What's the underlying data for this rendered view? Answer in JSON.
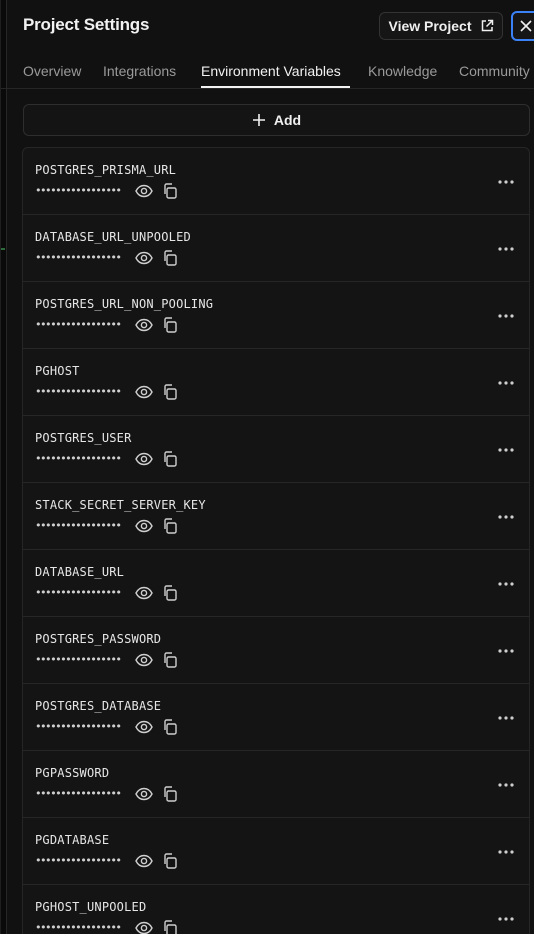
{
  "header": {
    "title": "Project Settings",
    "view_project_label": "View Project"
  },
  "tabs": [
    {
      "label": "Overview",
      "active": false
    },
    {
      "label": "Integrations",
      "active": false
    },
    {
      "label": "Environment Variables",
      "active": true
    },
    {
      "label": "Knowledge",
      "active": false
    },
    {
      "label": "Community",
      "active": false
    }
  ],
  "add_button_label": "Add",
  "masked_value": "•••••••••••••••••",
  "env_vars": [
    {
      "name": "POSTGRES_PRISMA_URL"
    },
    {
      "name": "DATABASE_URL_UNPOOLED"
    },
    {
      "name": "POSTGRES_URL_NON_POOLING"
    },
    {
      "name": "PGHOST"
    },
    {
      "name": "POSTGRES_USER"
    },
    {
      "name": "STACK_SECRET_SERVER_KEY"
    },
    {
      "name": "DATABASE_URL"
    },
    {
      "name": "POSTGRES_PASSWORD"
    },
    {
      "name": "POSTGRES_DATABASE"
    },
    {
      "name": "PGPASSWORD"
    },
    {
      "name": "PGDATABASE"
    },
    {
      "name": "PGHOST_UNPOOLED"
    }
  ],
  "colors": {
    "accent_focus": "#3b82f6",
    "background": "#111111",
    "row_background": "#141414"
  },
  "icons": {
    "external": "external-link-icon",
    "close": "close-icon",
    "add": "plus-icon",
    "reveal": "eye-icon",
    "copy": "copy-icon",
    "more": "more-horizontal-icon"
  }
}
